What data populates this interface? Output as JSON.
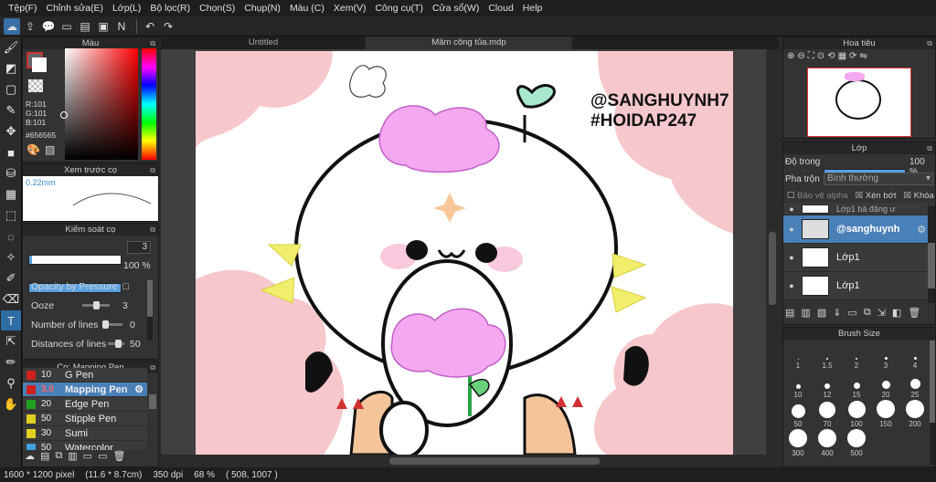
{
  "menu": [
    "Tệp(F)",
    "Chỉnh sửa(E)",
    "Lớp(L)",
    "Bộ lọc(R)",
    "Chọn(S)",
    "Chụp(N)",
    "Màu (C)",
    "Xem(V)",
    "Công cụ(T)",
    "Cửa sổ(W)",
    "Cloud",
    "Help"
  ],
  "toolbar_icons": [
    "cloud-icon",
    "export-icon",
    "chat-icon",
    "window-icon",
    "document-icon",
    "image-icon",
    "text-icon",
    "undo-icon",
    "redo-icon"
  ],
  "tools": [
    "brush-icon",
    "eraser-icon",
    "rect-select-icon",
    "pen-nib-icon",
    "move-icon",
    "fill-rect-icon",
    "bucket-icon",
    "gradient-icon",
    "select-icon",
    "lasso-icon",
    "magic-wand-icon",
    "select-pen-icon",
    "select-eraser-icon",
    "text-tool-icon",
    "operation-icon",
    "eyedropper-pen-icon",
    "eyedropper-icon",
    "hand-icon"
  ],
  "color": {
    "title": "Màu",
    "r": "R:101",
    "g": "G:101",
    "b": "B:101",
    "hex": "#656565",
    "fg": "#656565",
    "bg": "#ffffff"
  },
  "brush_preview": {
    "title": "Xem trước cọ",
    "size": "0.22mm"
  },
  "brush_control": {
    "title": "Kiểm soát cọ",
    "size_value": "3",
    "opacity_value": "100 %",
    "rows": [
      {
        "label": "Opacity by Pressure",
        "value": "□"
      },
      {
        "label": "Ooze",
        "value": "3"
      },
      {
        "label": "Number of lines",
        "value": "0"
      },
      {
        "label": "Distances of lines",
        "value": "50"
      }
    ]
  },
  "brush_list": {
    "title": "Cọ: Mapping Pen",
    "items": [
      {
        "size": "10",
        "name": "G Pen",
        "color": "#d02020"
      },
      {
        "size": "3.0",
        "name": "Mapping Pen",
        "color": "#d02020",
        "selected": true
      },
      {
        "size": "20",
        "name": "Edge Pen",
        "color": "#20a020"
      },
      {
        "size": "50",
        "name": "Stipple Pen",
        "color": "#e0d020"
      },
      {
        "size": "30",
        "name": "Sumi",
        "color": "#e0d020"
      },
      {
        "size": "50",
        "name": "Watercolor",
        "color": "#40a0e0"
      }
    ]
  },
  "tabs": [
    "Untitled",
    "Mâm công tủa.mdp"
  ],
  "artwork": {
    "watermark_line1": "@SANGHUYNH7",
    "watermark_line2": "#HOIDAP247"
  },
  "navigator": {
    "title": "Hoa tiêu"
  },
  "layers": {
    "title": "Lớp",
    "opacity_label": "Độ trong",
    "opacity_value": "100 %",
    "blend_label": "Pha trộn",
    "blend_value": "Bình thường",
    "protect_alpha": "Bảo vệ alpha",
    "clipping": "Xén bớt",
    "lock": "Khóa",
    "items": [
      {
        "name": "Lớp1 bả đặng ư",
        "partial": true
      },
      {
        "name": "@sanghuynh",
        "selected": true
      },
      {
        "name": "Lớp1"
      },
      {
        "name": "Lớp1"
      }
    ]
  },
  "brush_size": {
    "title": "Brush Size",
    "sizes": [
      "1",
      "1.5",
      "2",
      "3",
      "4",
      "10",
      "12",
      "15",
      "20",
      "25",
      "50",
      "70",
      "100",
      "150",
      "200",
      "300",
      "400",
      "500"
    ]
  },
  "status": {
    "dimensions": "1600 * 1200 pixel",
    "physical": "(11.6 * 8.7cm)",
    "dpi": "350 dpi",
    "zoom": "68 %",
    "coords": "( 508, 1007 )"
  }
}
